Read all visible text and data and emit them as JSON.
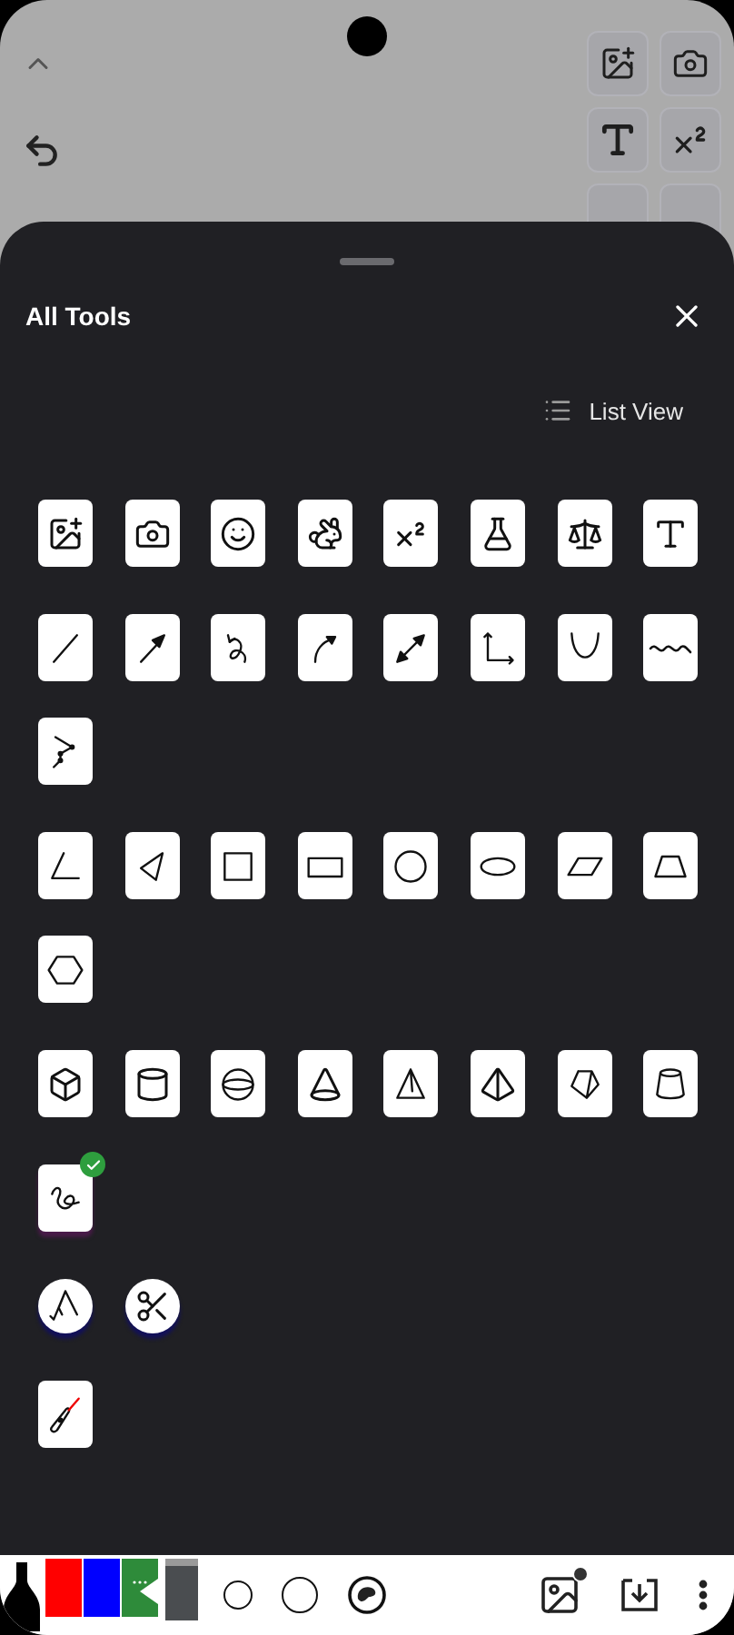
{
  "header": {
    "title": "All Tools"
  },
  "view_toggle": {
    "label": "List View"
  },
  "groups": [
    {
      "tools": [
        {
          "kind": "card",
          "selected": false
        },
        {
          "kind": "card",
          "selected": false
        },
        {
          "kind": "card",
          "selected": false
        },
        {
          "kind": "card",
          "selected": false
        },
        {
          "kind": "card",
          "selected": false
        },
        {
          "kind": "card",
          "selected": false
        },
        {
          "kind": "card",
          "selected": false
        },
        {
          "kind": "card",
          "selected": false
        }
      ]
    },
    {
      "tools": [
        {
          "kind": "card",
          "selected": false
        },
        {
          "kind": "card",
          "selected": false
        },
        {
          "kind": "card",
          "selected": false
        },
        {
          "kind": "card",
          "selected": false
        },
        {
          "kind": "card",
          "selected": false
        },
        {
          "kind": "card",
          "selected": false
        },
        {
          "kind": "card",
          "selected": false
        },
        {
          "kind": "card",
          "selected": false
        },
        {
          "kind": "card",
          "selected": false
        }
      ]
    },
    {
      "tools": [
        {
          "kind": "card",
          "selected": false
        },
        {
          "kind": "card",
          "selected": false
        },
        {
          "kind": "card",
          "selected": false
        },
        {
          "kind": "card",
          "selected": false
        },
        {
          "kind": "card",
          "selected": false
        },
        {
          "kind": "card",
          "selected": false
        },
        {
          "kind": "card",
          "selected": false
        },
        {
          "kind": "card",
          "selected": false
        },
        {
          "kind": "card",
          "selected": false
        }
      ]
    },
    {
      "tools": [
        {
          "kind": "card",
          "selected": false
        },
        {
          "kind": "card",
          "selected": false
        },
        {
          "kind": "card",
          "selected": false
        },
        {
          "kind": "card",
          "selected": false
        },
        {
          "kind": "card",
          "selected": false
        },
        {
          "kind": "card",
          "selected": false
        },
        {
          "kind": "card",
          "selected": false
        },
        {
          "kind": "card",
          "selected": false
        }
      ]
    },
    {
      "tools": [
        {
          "kind": "card",
          "selected": true
        }
      ]
    },
    {
      "tools": [
        {
          "kind": "round",
          "selected": false
        },
        {
          "kind": "round",
          "selected": false
        }
      ]
    },
    {
      "tools": [
        {
          "kind": "card",
          "selected": false
        }
      ]
    }
  ],
  "pens": [
    {
      "kind": "pen",
      "color": "#000000",
      "selected": false
    },
    {
      "kind": "swatch",
      "color": "#ff0000",
      "selected": false
    },
    {
      "kind": "swatch",
      "color": "#0000ff",
      "selected": false
    },
    {
      "kind": "swatch",
      "color": "#2e8b3a",
      "selected": true
    },
    {
      "kind": "marker",
      "color": "#4a4d50",
      "selected": false
    }
  ]
}
